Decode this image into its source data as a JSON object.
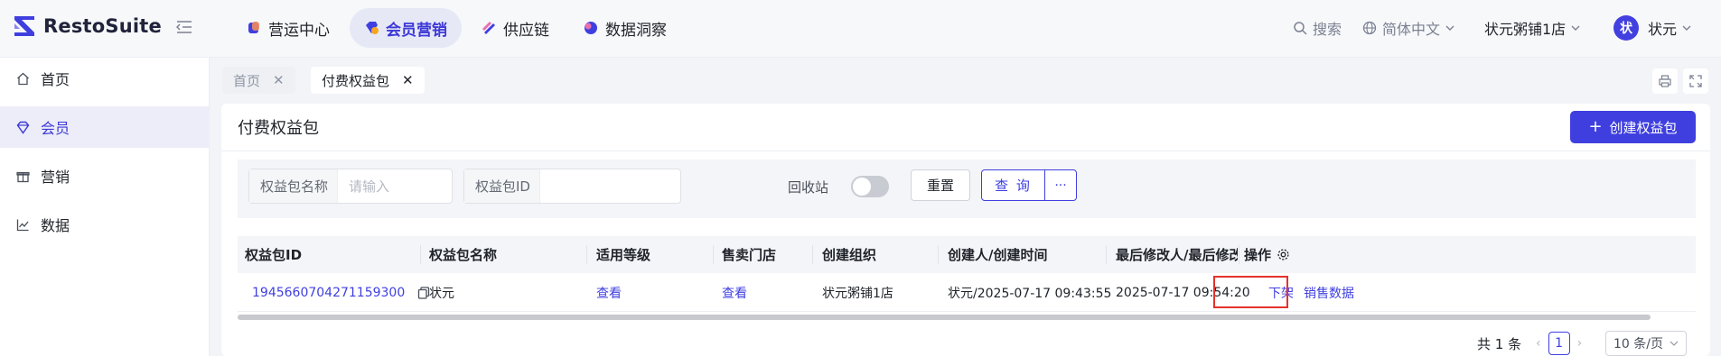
{
  "brand": {
    "name": "RestoSuite"
  },
  "topnav": [
    {
      "label": "营运中心",
      "icon": "operations-icon",
      "active": false
    },
    {
      "label": "会员营销",
      "icon": "member-marketing-icon",
      "active": true
    },
    {
      "label": "供应链",
      "icon": "supply-chain-icon",
      "active": false
    },
    {
      "label": "数据洞察",
      "icon": "data-insight-icon",
      "active": false
    }
  ],
  "header_tools": {
    "search": "搜索",
    "language": "简体中文",
    "store": "状元粥铺1店",
    "avatar_initial": "状",
    "user": "状元"
  },
  "sidebar": [
    {
      "label": "首页",
      "icon": "home-icon",
      "active": false
    },
    {
      "label": "会员",
      "icon": "diamond-icon",
      "active": true
    },
    {
      "label": "营销",
      "icon": "gift-icon",
      "active": false
    },
    {
      "label": "数据",
      "icon": "chart-line-icon",
      "active": false
    }
  ],
  "tabs": [
    {
      "label": "首页",
      "active": false
    },
    {
      "label": "付费权益包",
      "active": true
    }
  ],
  "page": {
    "title": "付费权益包",
    "create_button": "创建权益包"
  },
  "filters": {
    "name_label": "权益包名称",
    "name_placeholder": "请输入",
    "id_label": "权益包ID",
    "id_value": "",
    "recycle_label": "回收站",
    "recycle_on": false,
    "reset": "重置",
    "query": "查 询",
    "more": "···"
  },
  "table": {
    "columns": [
      "权益包ID",
      "权益包名称",
      "适用等级",
      "售卖门店",
      "创建组织",
      "创建人/创建时间",
      "最后修改人/最后修改时",
      "操作"
    ],
    "rows": [
      {
        "id": "1945660704271159300",
        "name": "状元",
        "level": "查看",
        "stores": "查看",
        "org": "状元粥铺1店",
        "creator": "状元/2025-07-17 09:43:55",
        "modified": "2025-07-17 09:54:20",
        "action_off": "下架",
        "action_sales": "销售数据"
      }
    ]
  },
  "pagination": {
    "total": "共 1 条",
    "current": "1",
    "page_size": "10 条/页"
  },
  "colors": {
    "accent": "#3f3fe0",
    "highlight_box": "#e5322d"
  }
}
